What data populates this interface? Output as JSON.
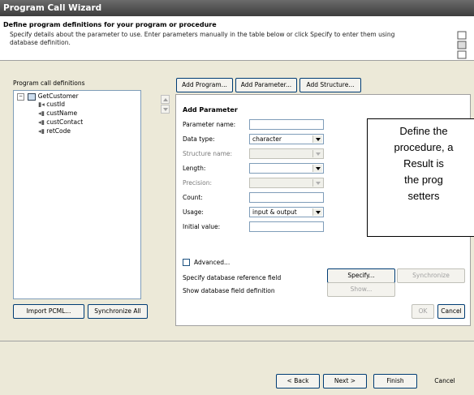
{
  "window": {
    "title": "Program Call Wizard"
  },
  "header": {
    "title": "Define program definitions for your program or procedure",
    "description": "Specify details about the parameter to use. Enter parameters manually in the table below or click Specify to enter them using database definition."
  },
  "tree": {
    "label": "Program call definitions",
    "root": "GetCustomer",
    "children": [
      "custId",
      "custName",
      "custContact",
      "retCode"
    ]
  },
  "left_buttons": {
    "import": "Import PCML...",
    "synchronize_all": "Synchronize All"
  },
  "toolbar": {
    "add_program": "Add Program...",
    "add_parameter": "Add Parameter...",
    "add_structure": "Add Structure..."
  },
  "form": {
    "heading": "Add Parameter",
    "labels": {
      "name": "Parameter name:",
      "type": "Data type:",
      "struct": "Structure name:",
      "length": "Length:",
      "precision": "Precision:",
      "count": "Count:",
      "usage": "Usage:",
      "initial": "Initial value:"
    },
    "values": {
      "name": "",
      "type": "character",
      "usage": "input & output"
    },
    "advanced": "Advanced...",
    "specify_label": "Specify database reference field",
    "show_label": "Show database field definition",
    "specify_button": "Specify...",
    "synchronize_button": "Synchronize",
    "show_button": "Show...",
    "ok_button": "OK",
    "cancel_button": "Cancel"
  },
  "callout": {
    "lines": [
      "Define the",
      "procedure, a",
      "Result is",
      "the prog",
      "setters"
    ]
  },
  "footer": {
    "back": "< Back",
    "next": "Next >",
    "finish": "Finish",
    "cancel": "Cancel"
  }
}
